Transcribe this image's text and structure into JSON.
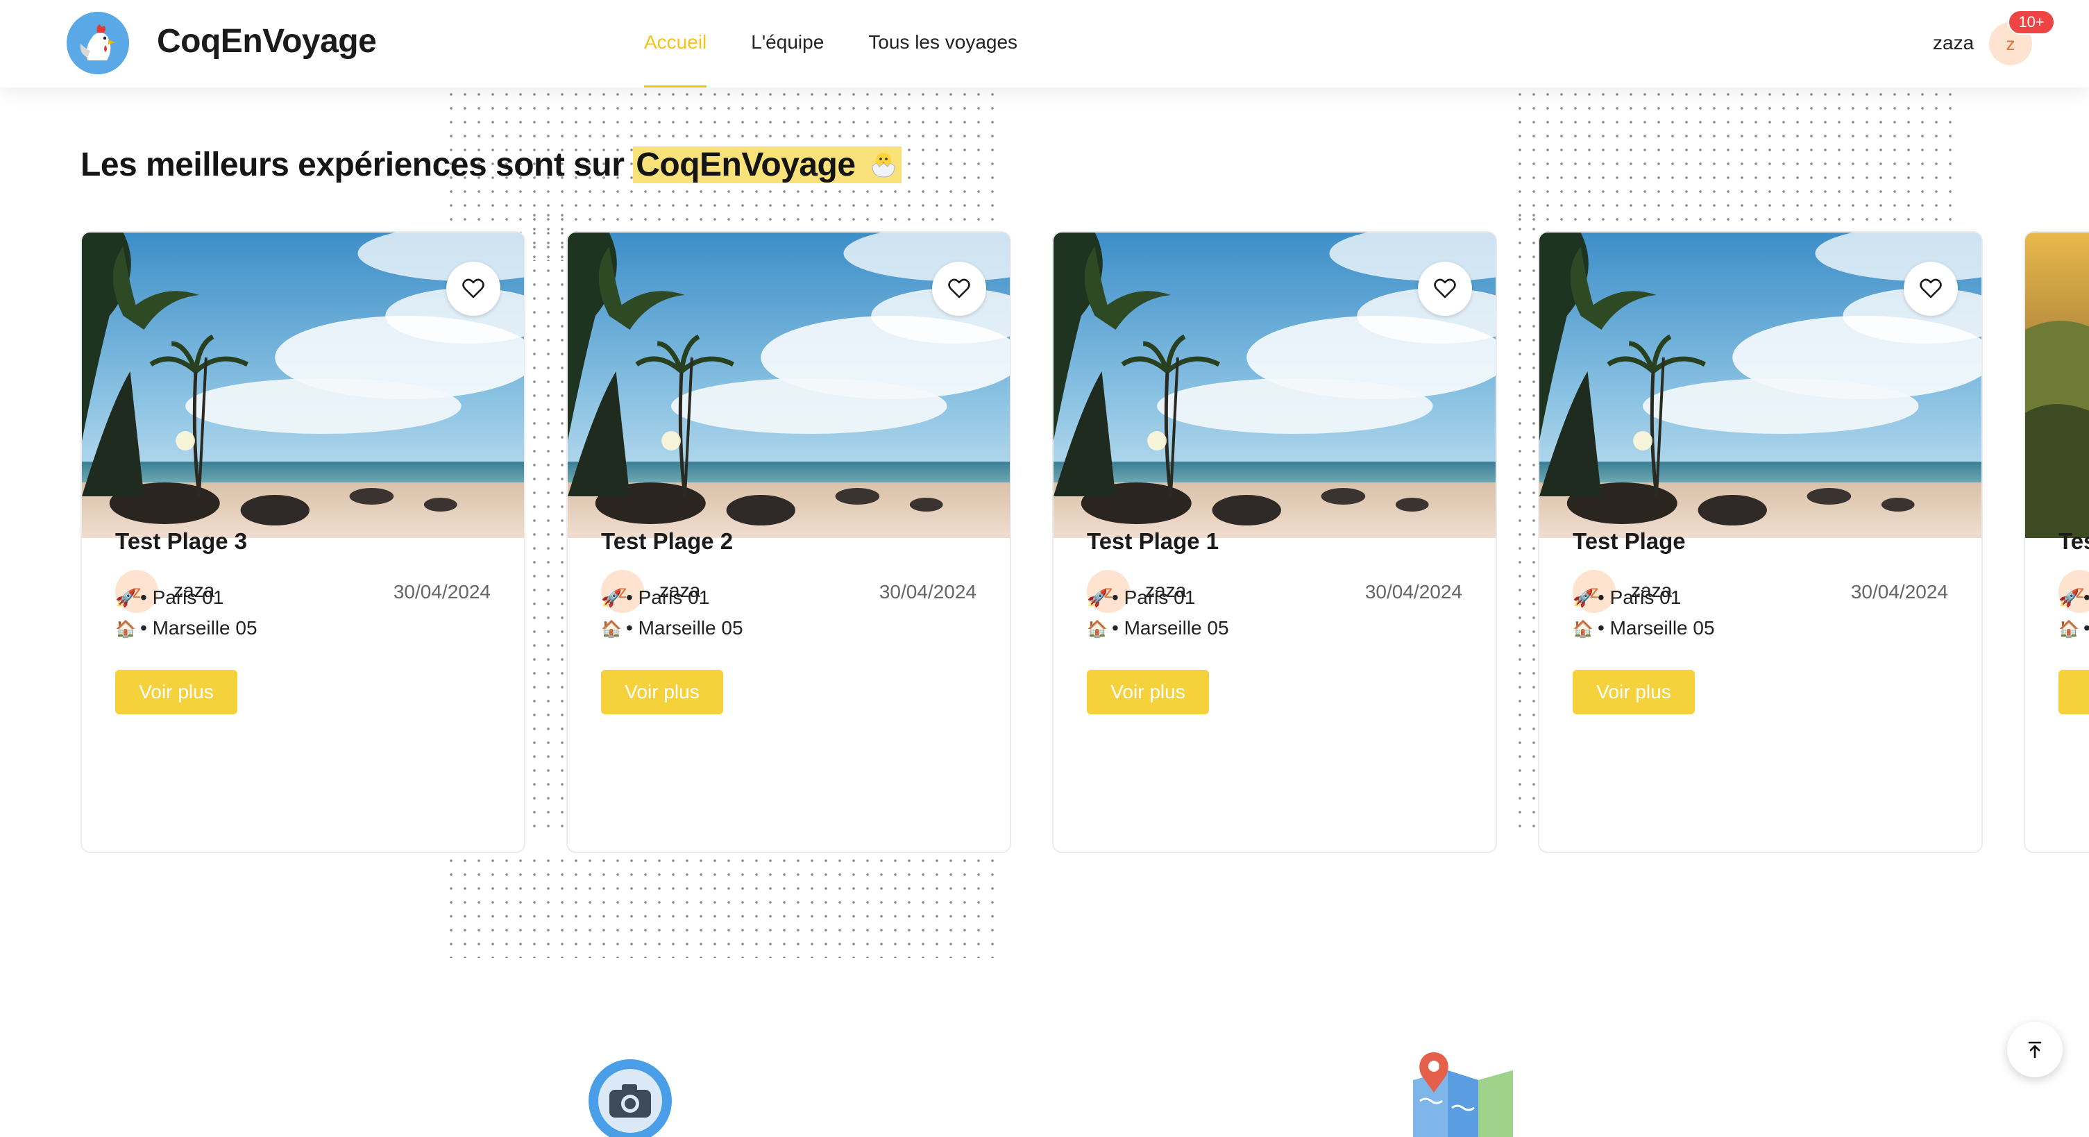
{
  "header": {
    "brand": "CoqEnVoyage",
    "nav": [
      {
        "label": "Accueil",
        "active": true
      },
      {
        "label": "L'équipe",
        "active": false
      },
      {
        "label": "Tous les voyages",
        "active": false
      }
    ],
    "user": {
      "name": "zaza",
      "initial": "z",
      "notifications": "10+"
    }
  },
  "main": {
    "title_prefix": "Les meilleurs expériences sont sur",
    "title_highlight": "CoqEnVoyage",
    "cards": [
      {
        "author": "zaza",
        "initial": "z",
        "date": "30/04/2024",
        "title": "Test Plage 3",
        "departure": "Paris 01",
        "arrival": "Marseille 05",
        "cta": "Voir plus"
      },
      {
        "author": "zaza",
        "initial": "z",
        "date": "30/04/2024",
        "title": "Test Plage 2",
        "departure": "Paris 01",
        "arrival": "Marseille 05",
        "cta": "Voir plus"
      },
      {
        "author": "zaza",
        "initial": "z",
        "date": "30/04/2024",
        "title": "Test Plage 1",
        "departure": "Paris 01",
        "arrival": "Marseille 05",
        "cta": "Voir plus"
      },
      {
        "author": "zaza",
        "initial": "z",
        "date": "30/04/2024",
        "title": "Test Plage",
        "departure": "Paris 01",
        "arrival": "Marseille 05",
        "cta": "Voir plus"
      },
      {
        "initial": "z",
        "title": "Tes"
      }
    ]
  },
  "icons": {
    "favorite": "heart-icon",
    "departure": "rocket-icon",
    "arrival": "house-icon",
    "scroll_top": "arrow-up-to-top-icon",
    "feature_1": "camera-icon",
    "feature_2": "map-pin-icon"
  },
  "colors": {
    "accent": "#f2c51d",
    "button": "#f5d13b",
    "badge": "#ef4444",
    "avatar_bg": "#fde3d0",
    "avatar_text": "#e0743a"
  }
}
